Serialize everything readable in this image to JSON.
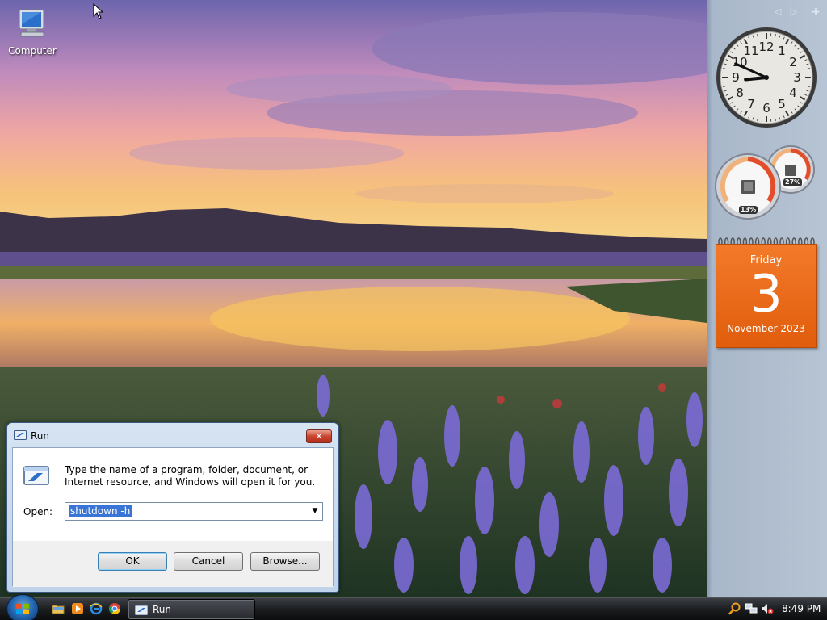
{
  "desktop": {
    "icons": [
      {
        "label": "Computer",
        "icon": "computer-icon"
      }
    ]
  },
  "gadgets": {
    "clock": {
      "hour": 8,
      "minute": 49
    },
    "cpu_meter": {
      "cpu_percent_label": "13%",
      "memory_percent_label": "27%",
      "cpu_percent": 13,
      "memory_percent": 27
    },
    "calendar": {
      "weekday": "Friday",
      "day": "3",
      "month_year": "November 2023"
    }
  },
  "run_dialog": {
    "title": "Run",
    "description": "Type the name of a program, folder, document, or Internet resource, and Windows will open it for you.",
    "open_label": "Open:",
    "input_value": "shutdown -h",
    "buttons": {
      "ok": "OK",
      "cancel": "Cancel",
      "browse": "Browse..."
    },
    "close_glyph": "✕"
  },
  "taskbar": {
    "quick_launch": [
      "folder-icon",
      "media-player-icon",
      "internet-explorer-icon",
      "chrome-icon"
    ],
    "task_buttons": [
      {
        "label": "Run",
        "icon": "run-icon"
      }
    ],
    "tray_icons": [
      "search-icon",
      "network-icon",
      "volume-muted-icon"
    ],
    "clock": "8:49 PM"
  },
  "colors": {
    "calendar_orange": "#e8650f",
    "selection_blue": "#3875d7",
    "close_red": "#c9452f"
  }
}
